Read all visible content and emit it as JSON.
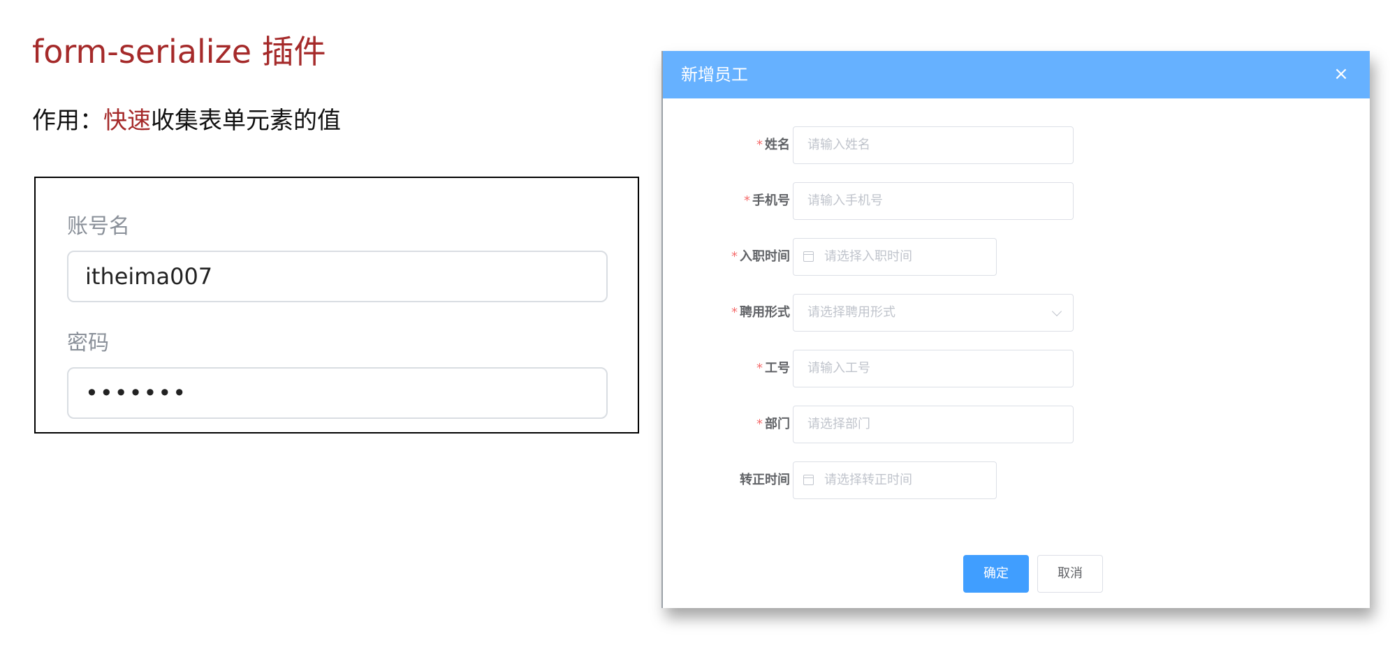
{
  "slide": {
    "title": "form-serialize 插件",
    "desc_prefix": "作用：",
    "desc_highlight": "快速",
    "desc_suffix": "收集表单元素的值",
    "demo_form": {
      "account_label": "账号名",
      "account_value": "itheima007",
      "password_label": "密码",
      "password_value": "•••••••"
    }
  },
  "dialog": {
    "title": "新增员工",
    "close_symbol": "×",
    "fields": [
      {
        "label": "姓名",
        "required": "*",
        "placeholder": "请输入姓名"
      },
      {
        "label": "手机号",
        "required": "*",
        "placeholder": "请输入手机号"
      },
      {
        "label": "入职时间",
        "required": "*",
        "placeholder": "请选择入职时间"
      },
      {
        "label": "聘用形式",
        "required": "*",
        "placeholder": "请选择聘用形式"
      },
      {
        "label": "工号",
        "required": "*",
        "placeholder": "请输入工号"
      },
      {
        "label": "部门",
        "required": "*",
        "placeholder": "请选择部门"
      },
      {
        "label": "转正时间",
        "required": "",
        "placeholder": "请选择转正时间"
      }
    ],
    "confirm_label": "确定",
    "cancel_label": "取消"
  },
  "colors": {
    "accent_red": "#a52a2a",
    "header_blue": "#66b1ff",
    "primary_button": "#409eff",
    "required_star": "#f56c6c"
  }
}
